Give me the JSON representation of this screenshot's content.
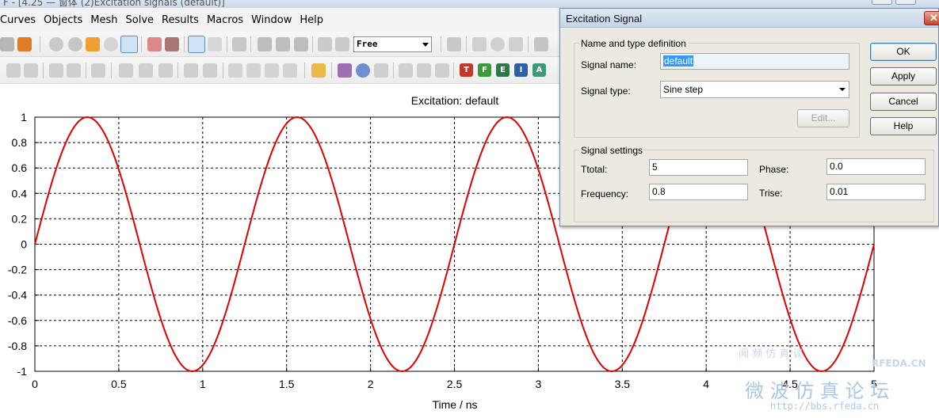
{
  "titlebar": {
    "text": "F - [4.25  — 窗体 (2)Excitation signals (default)]"
  },
  "menu": [
    "Curves",
    "Objects",
    "Mesh",
    "Solve",
    "Results",
    "Macros",
    "Window",
    "Help"
  ],
  "toolbar": {
    "mode_select": "Free",
    "result_buttons": [
      "T",
      "F",
      "E",
      "I",
      "A"
    ]
  },
  "chart_data": {
    "type": "line",
    "title": "Excitation: default",
    "xlabel": "Time / ns",
    "ylabel": "",
    "xlim": [
      0,
      5
    ],
    "ylim": [
      -1,
      1
    ],
    "grid": true,
    "x_ticks": [
      "0",
      "0.5",
      "1",
      "1.5",
      "2",
      "2.5",
      "3",
      "3.5",
      "4",
      "4.5",
      "5"
    ],
    "y_ticks": [
      "1",
      "0.8",
      "0.6",
      "0.4",
      "0.2",
      "0",
      "-0.2",
      "-0.4",
      "-0.6",
      "-0.8",
      "-1"
    ],
    "series": [
      {
        "function": "sin(2*pi*f*t)",
        "frequency": 0.8,
        "x_start": 0,
        "x_end": 5,
        "color": "#e00000"
      }
    ]
  },
  "dialog": {
    "title": "Excitation Signal",
    "group_name_type": "Name and type definition",
    "signal_name_label": "Signal name:",
    "signal_name_value": "default",
    "signal_type_label": "Signal type:",
    "signal_type_value": "Sine step",
    "edit_button": "Edit...",
    "group_settings": "Signal settings",
    "ttotal_label": "Ttotal:",
    "ttotal_value": "5",
    "phase_label": "Phase:",
    "phase_value": "0.0",
    "frequency_label": "Frequency:",
    "frequency_value": "0.8",
    "trise_label": "Trise:",
    "trise_value": "0.01",
    "buttons": {
      "ok": "OK",
      "apply": "Apply",
      "cancel": "Cancel",
      "help": "Help"
    }
  },
  "watermark": {
    "line1": "闻 频 仿 真 谈",
    "brand": "RFEDA.CN",
    "line2": "微 波 仿 真 论 坛",
    "url": "http://bbs.rfeda.cn"
  },
  "colors": {
    "curve": "#e00000",
    "dialog_bg": "#ece9e1",
    "selection": "#3399ff"
  }
}
